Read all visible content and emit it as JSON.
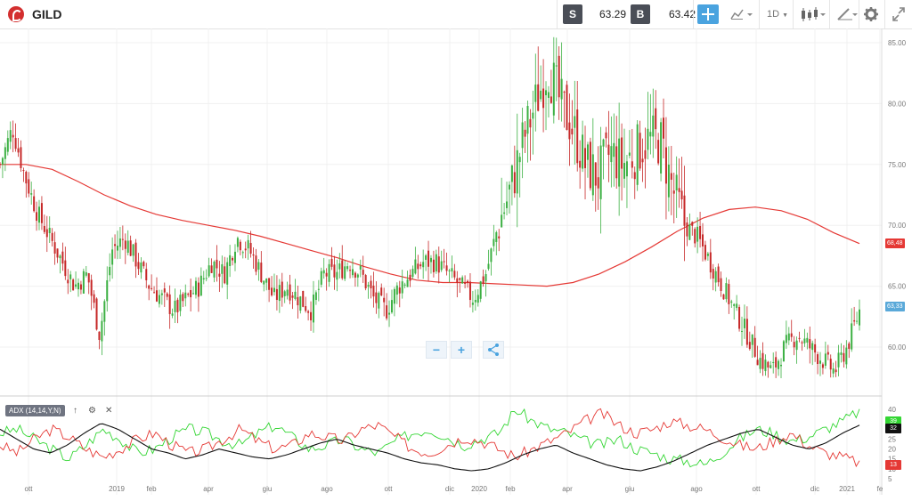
{
  "header": {
    "symbol": "GILD",
    "sell_label": "S",
    "sell_price": "63.29",
    "buy_label": "B",
    "buy_price": "63.42",
    "timeframe": "1D"
  },
  "icons": [
    "logo-icon",
    "crosshair-icon",
    "chart-type-icon",
    "candlestick-icon",
    "draw-icon",
    "gear-icon",
    "expand-icon"
  ],
  "price_axis": {
    "ticks": [
      "85.00",
      "80.00",
      "75.00",
      "70.00",
      "65.00",
      "60.00"
    ],
    "ma_badge": "68,48",
    "last_badge": "63,33"
  },
  "indicator": {
    "label": "ADX (14,14,Y,N)",
    "ticks": [
      "40",
      "35",
      "30",
      "25",
      "20",
      "15",
      "10",
      "5"
    ],
    "badges": {
      "plus_di": "39",
      "adx": "32",
      "minus_di": "13"
    }
  },
  "time_axis": [
    "ott",
    "2019",
    "feb",
    "apr",
    "giu",
    "ago",
    "ott",
    "dic",
    "2020",
    "feb",
    "apr",
    "giu",
    "ago",
    "ott",
    "dic",
    "2021",
    "fe"
  ],
  "zoom": {
    "minus": "−",
    "plus": "+",
    "share": "⋖"
  },
  "colors": {
    "up": "#3cb043",
    "down": "#c62828",
    "ma": "#e53935",
    "adx": "#111111",
    "plus_di": "#33d633",
    "minus_di": "#e53935",
    "accent": "#4aa3df"
  },
  "chart_data": {
    "type": "candlestick",
    "price_range": [
      56,
      86.5
    ],
    "ma": [
      75.0,
      75.0,
      74.6,
      73.6,
      72.5,
      71.6,
      70.9,
      70.4,
      70.0,
      69.6,
      69.1,
      68.5,
      67.9,
      67.3,
      66.6,
      66.0,
      65.5,
      65.3,
      65.3,
      65.2,
      65.1,
      65.0,
      65.3,
      66.0,
      67.0,
      68.2,
      69.5,
      70.6,
      71.3,
      71.5,
      71.2,
      70.5,
      69.4,
      68.5
    ],
    "close_series": [
      75,
      78,
      74,
      71,
      69,
      67,
      65,
      66,
      61,
      68,
      69,
      67,
      65,
      64,
      63,
      64,
      65,
      67,
      66,
      69,
      68,
      66,
      64,
      65,
      64,
      63,
      66,
      66,
      67,
      66,
      64,
      63,
      65,
      66,
      67,
      67,
      66,
      65,
      64,
      66,
      70,
      73,
      77,
      80,
      83,
      80,
      78,
      75,
      74,
      76,
      75,
      76,
      77,
      77,
      73,
      70,
      69,
      67,
      65,
      63,
      61,
      59,
      58,
      60,
      61,
      60,
      59,
      58,
      60,
      63
    ],
    "adx": [
      30,
      25,
      20,
      18,
      22,
      28,
      33,
      30,
      25,
      20,
      18,
      15,
      17,
      20,
      18,
      16,
      15,
      17,
      20,
      23,
      25,
      22,
      20,
      18,
      15,
      13,
      12,
      10,
      9,
      10,
      13,
      17,
      20,
      22,
      18,
      15,
      12,
      10,
      9,
      11,
      14,
      18,
      22,
      25,
      28,
      30,
      26,
      22,
      20,
      23,
      28,
      32
    ],
    "plus_di": [
      28,
      30,
      25,
      20,
      15,
      22,
      30,
      25,
      18,
      20,
      26,
      30,
      28,
      24,
      22,
      28,
      32,
      26,
      20,
      22,
      25,
      20,
      18,
      24,
      28,
      30,
      26,
      22,
      25,
      28,
      40,
      34,
      30,
      28,
      24,
      22,
      25,
      20,
      18,
      15,
      14,
      12,
      18,
      25,
      30,
      28,
      24,
      26,
      30,
      34,
      39
    ],
    "minus_di": [
      22,
      18,
      25,
      30,
      26,
      20,
      16,
      20,
      25,
      28,
      22,
      18,
      20,
      25,
      30,
      24,
      20,
      22,
      28,
      26,
      24,
      30,
      32,
      26,
      20,
      18,
      22,
      26,
      24,
      20,
      16,
      20,
      24,
      28,
      34,
      38,
      32,
      28,
      30,
      34,
      32,
      30,
      26,
      22,
      20,
      24,
      28,
      22,
      18,
      16,
      13
    ]
  }
}
